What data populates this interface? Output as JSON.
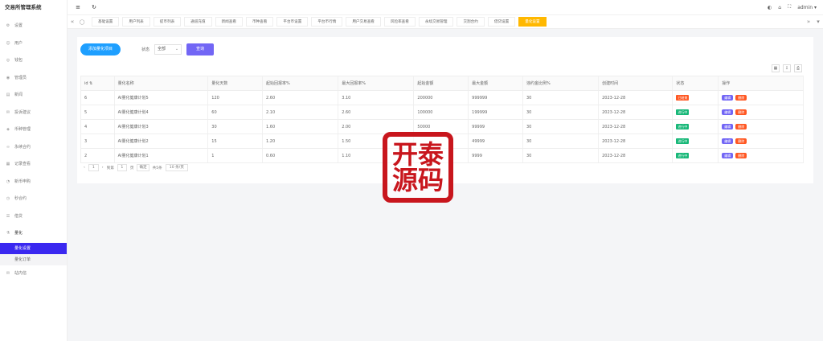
{
  "app": {
    "title": "交易所管理系统"
  },
  "sidebar": {
    "items": [
      {
        "icon": "gear-icon",
        "glyph": "⚙",
        "label": "设置"
      },
      {
        "icon": "user-icon",
        "glyph": "☺",
        "label": "用户"
      },
      {
        "icon": "wallet-icon",
        "glyph": "◎",
        "label": "钱包"
      },
      {
        "icon": "admin-icon",
        "glyph": "◉",
        "label": "管理员"
      },
      {
        "icon": "news-icon",
        "glyph": "▤",
        "label": "新闻"
      },
      {
        "icon": "feedback-icon",
        "glyph": "✉",
        "label": "投诉建议"
      },
      {
        "icon": "coin-icon",
        "glyph": "◈",
        "label": "币种管理"
      },
      {
        "icon": "contract-icon",
        "glyph": "∞",
        "label": "永续合约"
      },
      {
        "icon": "record-icon",
        "glyph": "▦",
        "label": "记录查看"
      },
      {
        "icon": "subscribe-icon",
        "glyph": "◔",
        "label": "新币申购"
      },
      {
        "icon": "second-contract-icon",
        "glyph": "◷",
        "label": "秒合约"
      },
      {
        "icon": "loan-icon",
        "glyph": "☰",
        "label": "借贷"
      },
      {
        "icon": "quant-icon",
        "glyph": "⚗",
        "label": "量化"
      }
    ],
    "sub_items": [
      {
        "label": "量化设置"
      },
      {
        "label": "量化订单"
      }
    ],
    "last_item": {
      "icon": "mail-icon",
      "glyph": "✉",
      "label": "站内信"
    }
  },
  "header": {
    "user": "admin",
    "caret": "▾",
    "menu_glyph": "≡",
    "refresh_glyph": "↻"
  },
  "tabs": {
    "prev": "«",
    "next": "»",
    "home_glyph": "◯",
    "items": [
      {
        "label": "基础设置",
        "active": false
      },
      {
        "label": "用户列表",
        "active": false
      },
      {
        "label": "提币列表",
        "active": false
      },
      {
        "label": "通道充值",
        "active": false
      },
      {
        "label": "新闻查看",
        "active": false
      },
      {
        "label": "币种查看",
        "active": false
      },
      {
        "label": "平台币设置",
        "active": false
      },
      {
        "label": "平台币行情",
        "active": false
      },
      {
        "label": "用户交易查看",
        "active": false
      },
      {
        "label": "风险率查看",
        "active": false
      },
      {
        "label": "永续交易管理",
        "active": false
      },
      {
        "label": "交割合约",
        "active": false
      },
      {
        "label": "借贷设置",
        "active": false
      },
      {
        "label": "量化设置",
        "active": true
      }
    ]
  },
  "toolbar": {
    "add_label": "添加量化项目",
    "status_label": "状态",
    "status_value": "全部",
    "query_label": "查询"
  },
  "table": {
    "columns": [
      "id ⇅",
      "量化名称",
      "量化天数",
      "起始回报率%",
      "最大回报率%",
      "起始金额",
      "最大金额",
      "违约金比例%",
      "创建时间",
      "状态",
      "操作"
    ],
    "rows": [
      {
        "id": "6",
        "name": "AI量化健康计划5",
        "days": "120",
        "min_rate": "2.60",
        "max_rate": "3.10",
        "min_amount": "200000",
        "max_amount": "999999",
        "penalty": "30",
        "created": "2023-12-28",
        "status": "已结束",
        "status_type": "done"
      },
      {
        "id": "5",
        "name": "AI量化健康计划4",
        "days": "60",
        "min_rate": "2.10",
        "max_rate": "2.60",
        "min_amount": "100000",
        "max_amount": "199999",
        "penalty": "30",
        "created": "2023-12-28",
        "status": "进行中",
        "status_type": "run"
      },
      {
        "id": "4",
        "name": "AI量化健康计划3",
        "days": "30",
        "min_rate": "1.60",
        "max_rate": "2.00",
        "min_amount": "50000",
        "max_amount": "99999",
        "penalty": "30",
        "created": "2023-12-28",
        "status": "进行中",
        "status_type": "run"
      },
      {
        "id": "3",
        "name": "AI量化健康计划2",
        "days": "15",
        "min_rate": "1.20",
        "max_rate": "1.50",
        "min_amount": "",
        "max_amount": "49999",
        "penalty": "30",
        "created": "2023-12-28",
        "status": "进行中",
        "status_type": "run"
      },
      {
        "id": "2",
        "name": "AI量化健康计划1",
        "days": "1",
        "min_rate": "0.60",
        "max_rate": "1.10",
        "min_amount": "",
        "max_amount": "9999",
        "penalty": "30",
        "created": "2023-12-28",
        "status": "进行中",
        "status_type": "run"
      }
    ],
    "edit_label": "编辑",
    "delete_label": "删除"
  },
  "pager": {
    "prev": "‹",
    "page": "1",
    "next": "›",
    "goto_prefix": "到第",
    "goto_value": "1",
    "goto_suffix": "页",
    "confirm": "确定",
    "total": "共5条",
    "page_size": "10 条/页"
  },
  "stamp": {
    "chars": [
      "开",
      "泰",
      "源",
      "码"
    ]
  },
  "colors": {
    "primary": "#3a28f0",
    "add_button": "#1e9fff",
    "query_button": "#7266f5",
    "active_tab": "#ffb800",
    "running": "#16b777",
    "ended": "#ff5722",
    "stamp": "#c8161d"
  }
}
